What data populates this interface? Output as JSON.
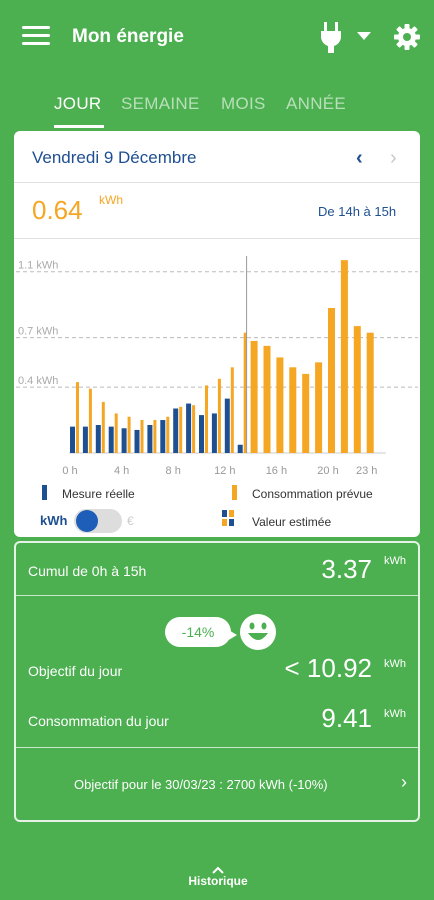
{
  "app": {
    "title": "Mon énergie"
  },
  "tabs": [
    {
      "label": "JOUR",
      "active": true
    },
    {
      "label": "SEMAINE",
      "active": false
    },
    {
      "label": "MOIS",
      "active": false
    },
    {
      "label": "ANNÉE",
      "active": false
    }
  ],
  "day_card": {
    "date": "Vendredi 9 Décembre",
    "current_value_int": "0.64",
    "current_unit": "kWh",
    "time_range": "De 14h à 15h"
  },
  "chart_data": {
    "type": "bar",
    "title": "",
    "ylabel": "kWh",
    "y_gridlines": [
      0.4,
      0.7,
      1.1
    ],
    "y_tick_labels": [
      "0.4 kWh",
      "0.7 kWh",
      "1.1 kWh"
    ],
    "ylim": [
      0,
      1.25
    ],
    "x_tick_labels": [
      "0 h",
      "4 h",
      "8 h",
      "12 h",
      "16 h",
      "20 h",
      "23 h"
    ],
    "x_tick_hours": [
      0,
      4,
      8,
      12,
      16,
      20,
      23
    ],
    "selected_hour": 14,
    "series": [
      {
        "name": "Mesure réelle",
        "color": "#1e4f91",
        "hours": [
          0,
          1,
          2,
          3,
          4,
          5,
          6,
          7,
          8,
          9,
          10,
          11,
          12,
          13
        ],
        "values": [
          0.16,
          0.16,
          0.17,
          0.16,
          0.15,
          0.14,
          0.17,
          0.2,
          0.27,
          0.3,
          0.23,
          0.24,
          0.33,
          0.05
        ]
      },
      {
        "name": "Consommation prévue",
        "color": "#f5a623",
        "hours": [
          0,
          1,
          2,
          3,
          4,
          5,
          6,
          7,
          8,
          9,
          10,
          11,
          12,
          13,
          14,
          15,
          16,
          17,
          18,
          19,
          20,
          21,
          22,
          23
        ],
        "values": [
          0.43,
          0.39,
          0.31,
          0.24,
          0.22,
          0.2,
          0.2,
          0.22,
          0.28,
          0.29,
          0.41,
          0.45,
          0.52,
          0.73,
          0.68,
          0.65,
          0.58,
          0.52,
          0.48,
          0.55,
          0.88,
          1.17,
          0.77,
          0.73
        ]
      }
    ]
  },
  "legend": {
    "real": "Mesure réelle",
    "forecast": "Consommation prévue",
    "estimated": "Valeur estimée",
    "toggle_kwh": "kWh",
    "toggle_euro": "€"
  },
  "summary": {
    "cumul_label": "Cumul de 0h à 15h",
    "cumul_value": "3.37",
    "unit": "kWh",
    "delta_badge": "-14%",
    "objective_label": "Objectif du jour",
    "objective_value": "< 10.92",
    "consumption_label": "Consommation du jour",
    "consumption_value": "9.41",
    "target_text": "Objectif pour le 30/03/23 : 2700 kWh (-10%)"
  },
  "footer": {
    "history_label": "Historique"
  }
}
